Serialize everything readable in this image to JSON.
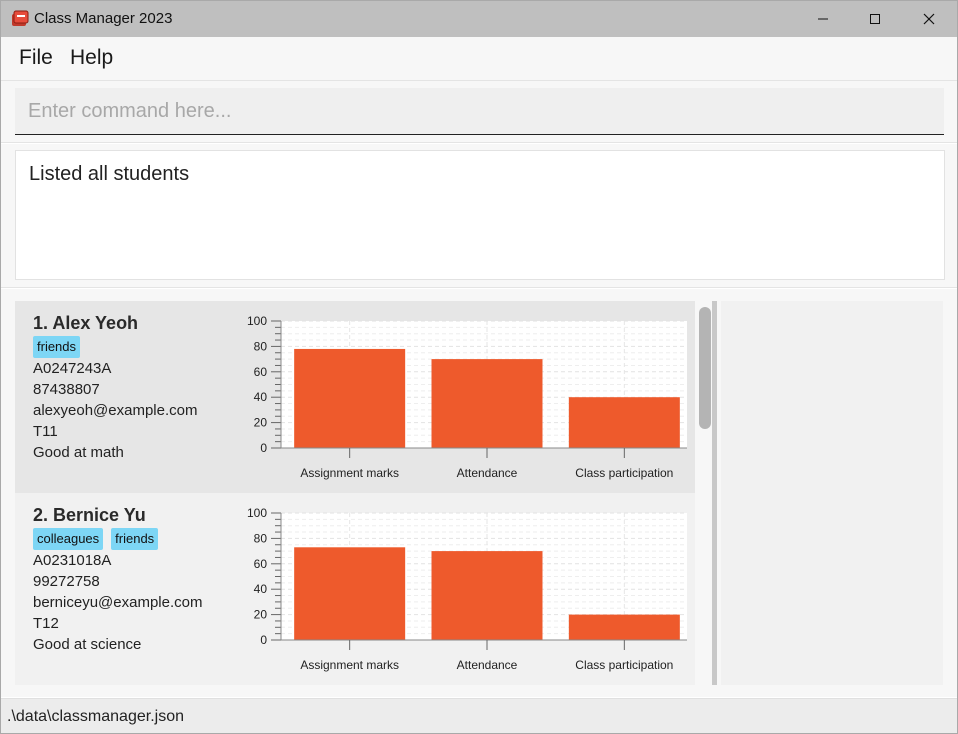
{
  "window": {
    "title": "Class Manager 2023"
  },
  "menu": {
    "items": [
      "File",
      "Help"
    ]
  },
  "command": {
    "placeholder": "Enter command here...",
    "value": ""
  },
  "result": {
    "text": "Listed all students"
  },
  "students": [
    {
      "name": "1.  Alex Yeoh",
      "tags": [
        "friends"
      ],
      "student_number": "A0247243A",
      "phone": "87438807",
      "email": "alexyeoh@example.com",
      "class_number": "T11",
      "comment": "Good at math"
    },
    {
      "name": "2.  Bernice Yu",
      "tags": [
        "colleagues",
        "friends"
      ],
      "student_number": "A0231018A",
      "phone": "99272758",
      "email": "berniceyu@example.com",
      "class_number": "T12",
      "comment": "Good at science"
    }
  ],
  "status": {
    "file_path": ".\\data\\classmanager.json"
  },
  "colors": {
    "bar": "#ee5a2c",
    "tag": "#7dd6f5",
    "titlebar": "#bfbfbf"
  },
  "chart_data": [
    {
      "type": "bar",
      "categories": [
        "Assignment marks",
        "Attendance",
        "Class participation"
      ],
      "values": [
        78,
        70,
        40
      ],
      "ylim": [
        0,
        100
      ],
      "yticks": [
        0,
        20,
        40,
        60,
        80,
        100
      ],
      "grid": true
    },
    {
      "type": "bar",
      "categories": [
        "Assignment marks",
        "Attendance",
        "Class participation"
      ],
      "values": [
        73,
        70,
        20
      ],
      "ylim": [
        0,
        100
      ],
      "yticks": [
        0,
        20,
        40,
        60,
        80,
        100
      ],
      "grid": true
    }
  ]
}
